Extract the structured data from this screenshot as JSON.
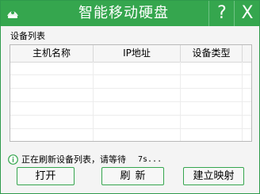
{
  "window": {
    "title": "智能移动硬盘",
    "help_label": "?",
    "close_label": "X",
    "logo_icon": "green-dome-logo-icon",
    "accent_color": "#35a64e"
  },
  "device_list": {
    "label": "设备列表",
    "columns": [
      "主机名称",
      "IP地址",
      "设备类型"
    ],
    "rows": []
  },
  "status": {
    "icon": "info-icon",
    "message": "正在刷新设备列表，请等待",
    "countdown": "7s..."
  },
  "buttons": {
    "open": "打开",
    "refresh": "刷新",
    "map": "建立映射"
  }
}
